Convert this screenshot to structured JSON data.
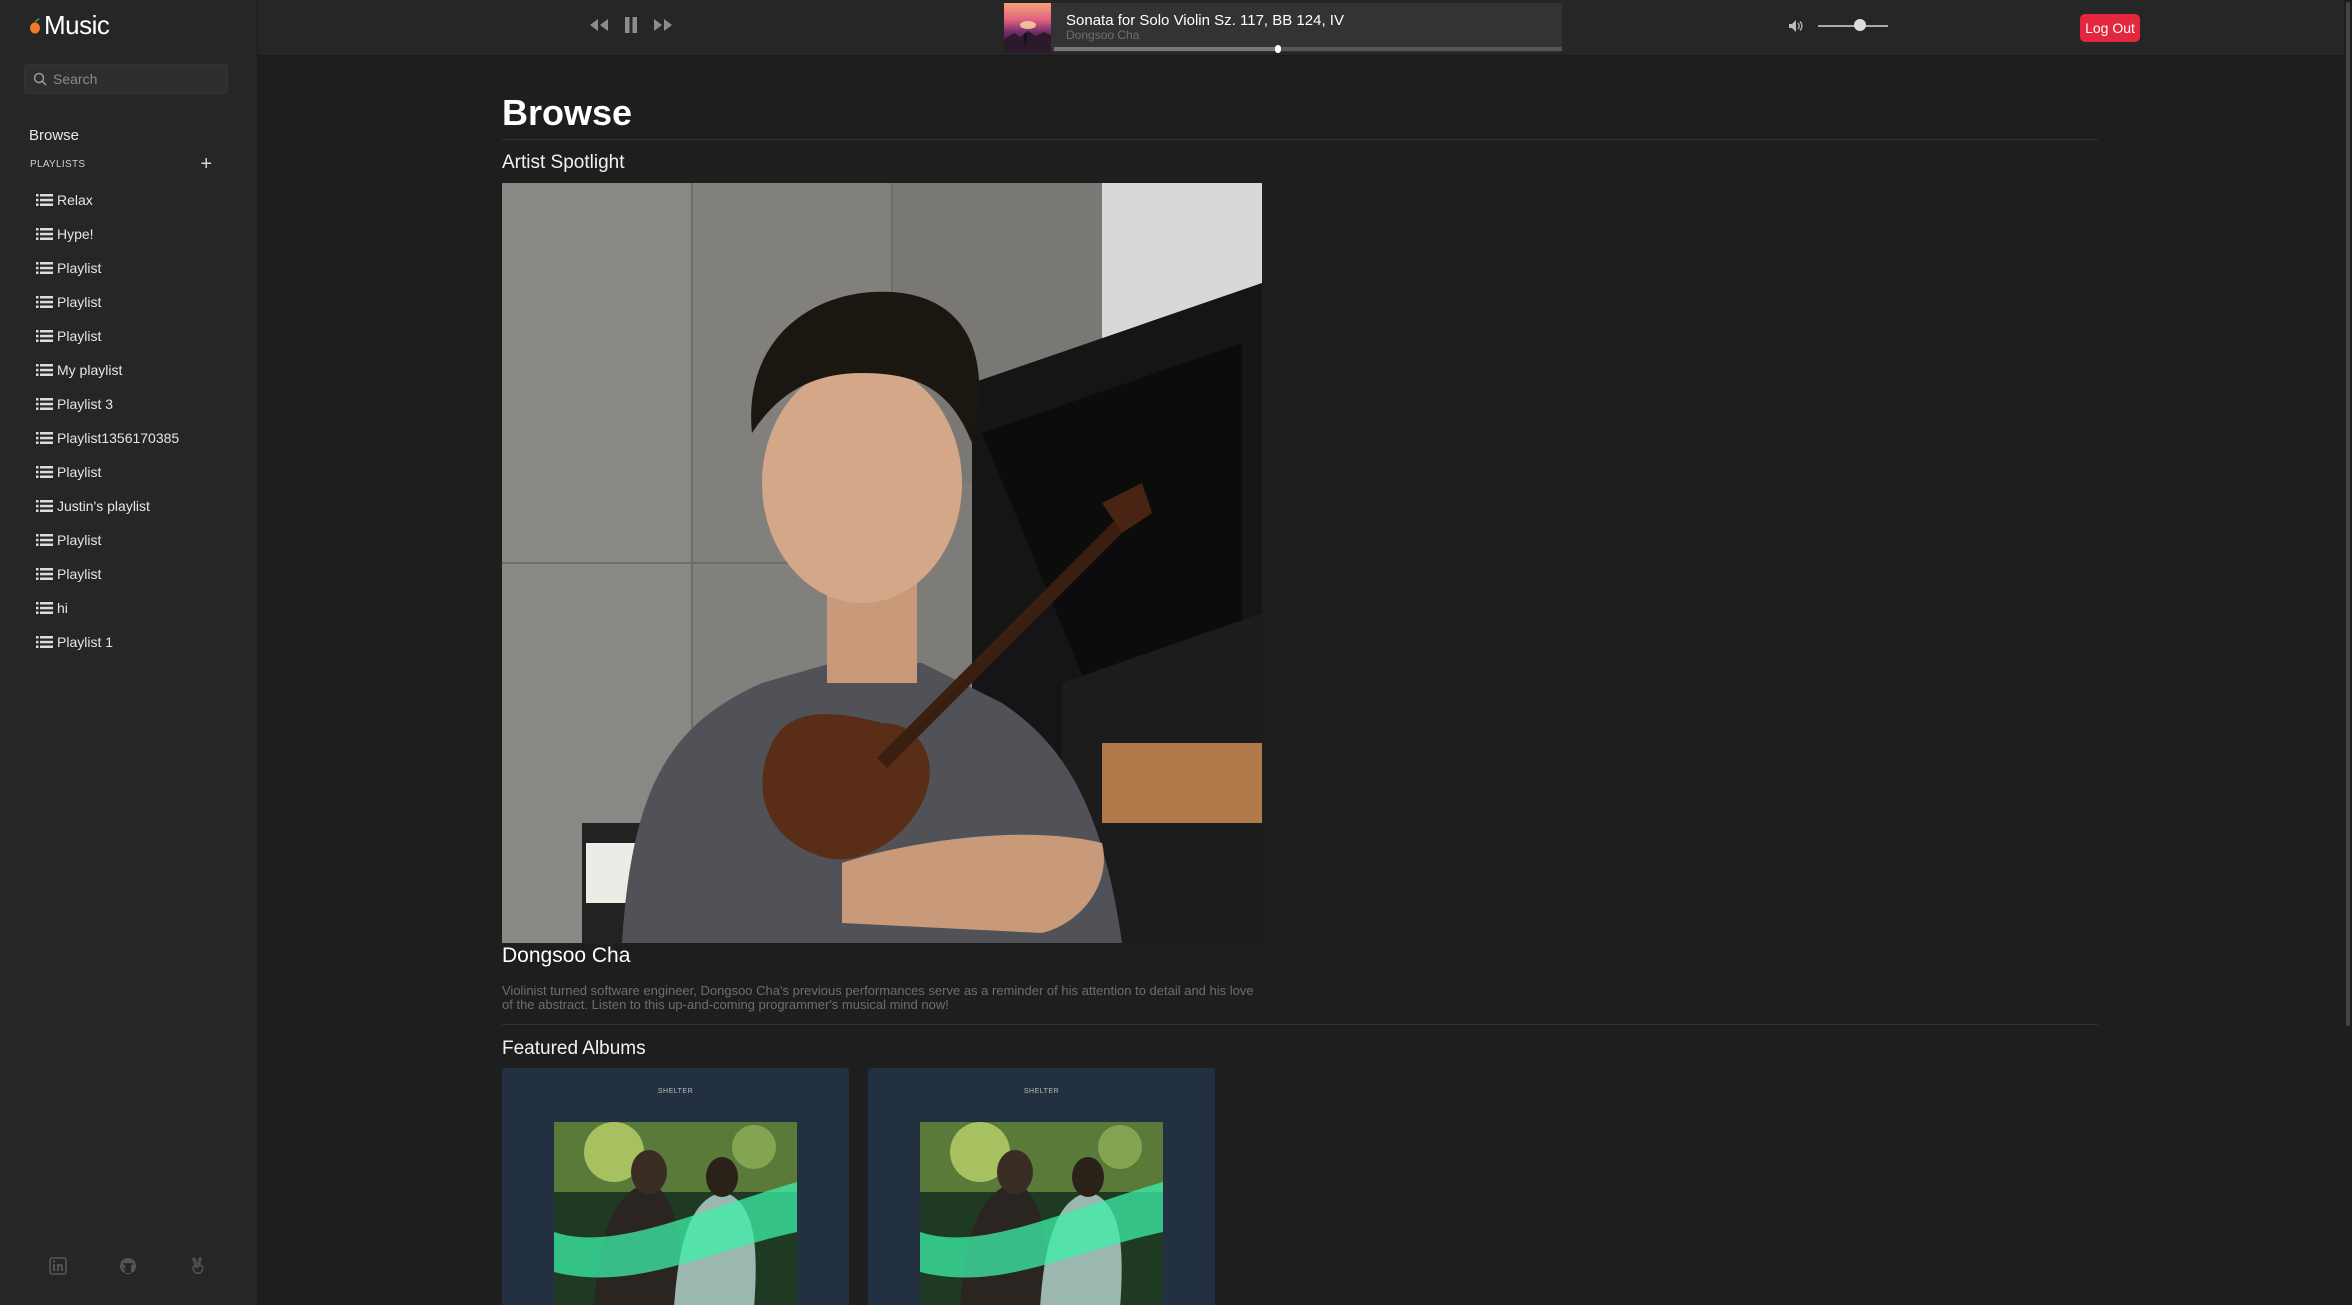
{
  "app": {
    "title": "Music"
  },
  "sidebar": {
    "search_placeholder": "Search",
    "browse_label": "Browse",
    "playlists_label": "PLAYLISTS",
    "add_label": "+",
    "playlists": [
      {
        "label": "Relax"
      },
      {
        "label": "Hype!"
      },
      {
        "label": "Playlist"
      },
      {
        "label": "Playlist"
      },
      {
        "label": "Playlist"
      },
      {
        "label": "My playlist"
      },
      {
        "label": "Playlist 3"
      },
      {
        "label": "Playlist1356170385"
      },
      {
        "label": "Playlist"
      },
      {
        "label": "Justin's playlist"
      },
      {
        "label": "Playlist"
      },
      {
        "label": "Playlist"
      },
      {
        "label": "hi"
      },
      {
        "label": "Playlist 1"
      }
    ],
    "footer_icons": [
      "linkedin-icon",
      "github-icon",
      "angellist-icon"
    ]
  },
  "player": {
    "controls": [
      "rewind-icon",
      "pause-icon",
      "fast-forward-icon"
    ],
    "track_title": "Sonata for Solo Violin Sz. 117, BB 124, IV",
    "track_artist": "Dongsoo Cha",
    "progress": 0.44,
    "volume": 0.6,
    "logout_label": "Log Out"
  },
  "main": {
    "page_title": "Browse",
    "spotlight_title": "Artist Spotlight",
    "artist_name": "Dongsoo Cha",
    "artist_bio": "Violinist turned software engineer, Dongsoo Cha's previous performances serve as a reminder of his attention to detail and his love of the abstract. Listen to this up-and-coming programmer's musical mind now!",
    "featured_title": "Featured Albums",
    "albums": [
      {
        "label": "SHELTER"
      },
      {
        "label": "SHELTER"
      }
    ]
  },
  "colors": {
    "background": "#1e1e1e",
    "sidebar": "#262626",
    "accent_red": "#e3273f",
    "album_card": "#233041"
  }
}
